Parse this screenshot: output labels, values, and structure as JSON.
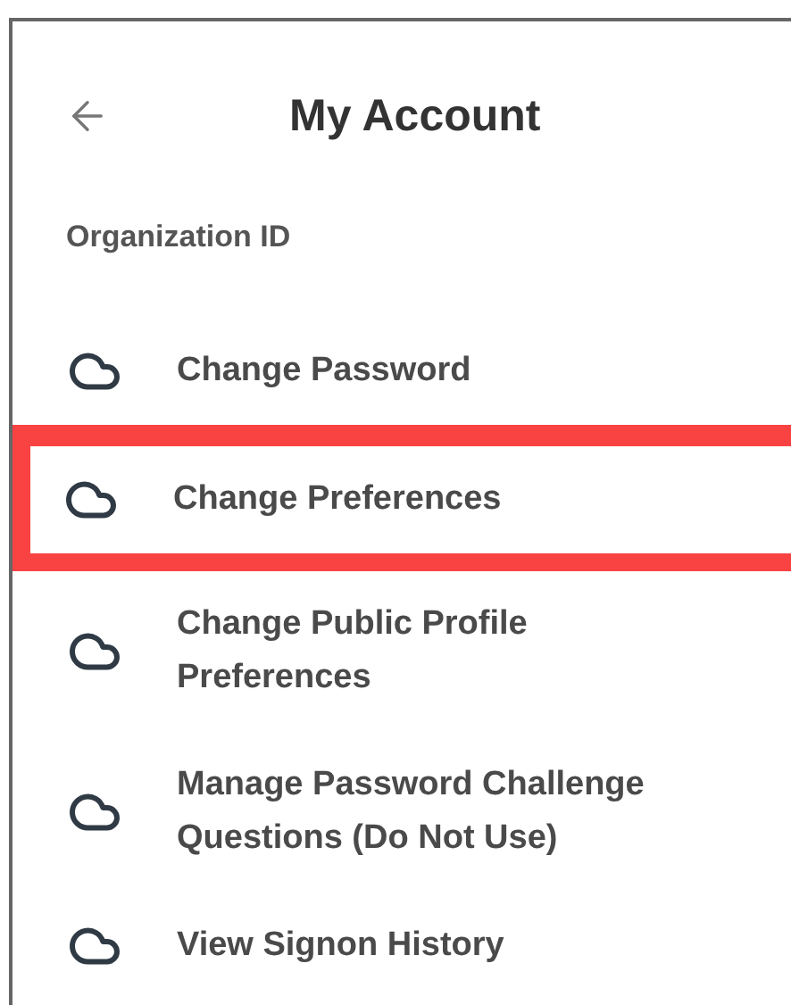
{
  "header": {
    "title": "My Account"
  },
  "section_label": "Organization ID",
  "items": [
    {
      "label": "Change Password",
      "highlighted": false
    },
    {
      "label": "Change Preferences",
      "highlighted": true
    },
    {
      "label": "Change Public Profile Preferences",
      "highlighted": false
    },
    {
      "label": "Manage Password Challenge Questions (Do Not Use)",
      "highlighted": false
    },
    {
      "label": "View Signon History",
      "highlighted": false
    }
  ]
}
